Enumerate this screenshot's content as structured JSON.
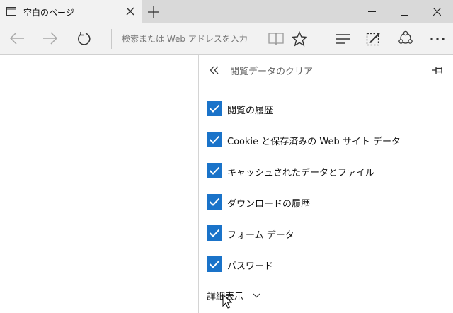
{
  "tab": {
    "title": "空白のページ",
    "icon": "page-icon"
  },
  "address": {
    "placeholder": "検索または Web アドレスを入力"
  },
  "toolbar": {
    "icons": [
      "back-arrow-icon",
      "forward-arrow-icon",
      "refresh-icon",
      "reading-view-icon",
      "favorite-star-icon",
      "hub-icon",
      "web-note-icon",
      "share-icon",
      "more-icon"
    ]
  },
  "window_controls": [
    "minimize-icon",
    "maximize-icon",
    "close-icon"
  ],
  "panel": {
    "title": "閲覧データのクリア",
    "options": [
      {
        "label": "閲覧の履歴",
        "checked": true
      },
      {
        "label": "Cookie と保存済みの Web サイト データ",
        "checked": true
      },
      {
        "label": "キャッシュされたデータとファイル",
        "checked": true
      },
      {
        "label": "ダウンロードの履歴",
        "checked": true
      },
      {
        "label": "フォーム データ",
        "checked": true
      },
      {
        "label": "パスワード",
        "checked": true
      }
    ],
    "details_label": "詳細表示"
  },
  "colors": {
    "accent": "#1a73c9",
    "titlebar": "#d9d9d9",
    "toolbar": "#f2f2f2"
  }
}
